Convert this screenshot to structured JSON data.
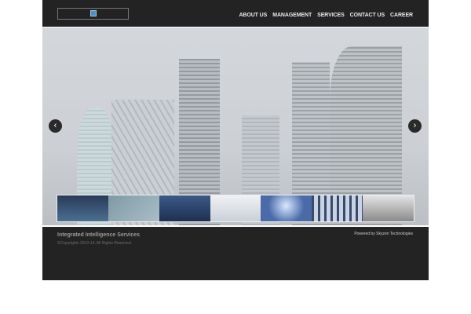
{
  "header": {
    "logo_icon": "logo-icon",
    "nav": [
      "ABOUT US",
      "MANAGEMENT",
      "SERVICES",
      "CONTACT US",
      "CAREER"
    ]
  },
  "slider": {
    "prev_icon": "‹",
    "next_icon": "›",
    "thumbnails": [
      "city-skyline",
      "finance",
      "lights",
      "office-people",
      "stage",
      "silhouettes",
      "desk-equipment"
    ]
  },
  "footer": {
    "title": "Integrated Intelligence Services",
    "copyright": "©Copyrights 2013-14, All Rights Reserved.",
    "powered": "Powered by Skyzen Technologies"
  }
}
